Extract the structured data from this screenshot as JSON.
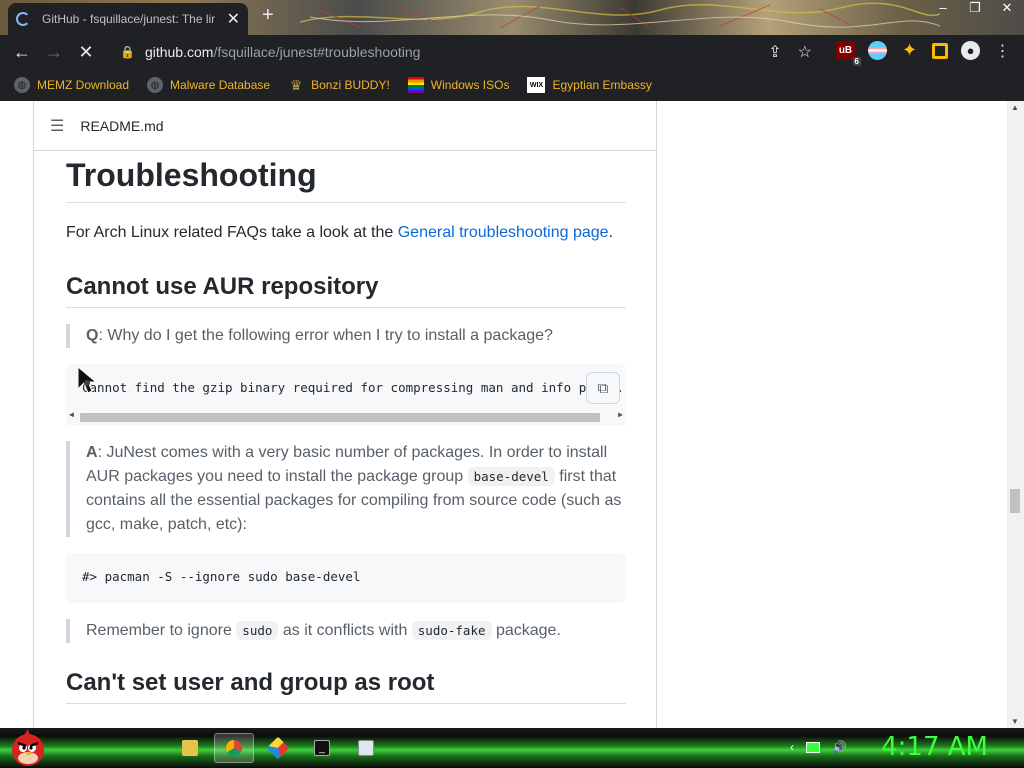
{
  "browser": {
    "tab_title": "GitHub - fsquillace/junest: The lir",
    "tab_close": "✕",
    "new_tab": "+",
    "url_host": "github.com",
    "url_path": "/fsquillace/junest#troubleshooting",
    "extension_badge": "6",
    "ublock_label": "uB"
  },
  "bookmarks": [
    {
      "label": "MEMZ Download",
      "icon": "globe-icon"
    },
    {
      "label": "Malware Database",
      "icon": "globe-icon"
    },
    {
      "label": "Bonzi BUDDY!",
      "icon": "bonzi-icon"
    },
    {
      "label": "Windows ISOs",
      "icon": "rainbow-flag-icon"
    },
    {
      "label": "Egyptian Embassy",
      "icon": "wix-icon"
    }
  ],
  "readme": {
    "filename": "README.md",
    "h1": "Troubleshooting",
    "intro_prefix": "For Arch Linux related FAQs take a look at the ",
    "intro_link": "General troubleshooting page",
    "intro_suffix": ".",
    "h2_aur": "Cannot use AUR repository",
    "q_label": "Q",
    "q_text": ": Why do I get the following error when I try to install a package?",
    "error_code": "Cannot find the gzip binary required for compressing man and info pages.",
    "a_label": "A",
    "a_text_1": ": JuNest comes with a very basic number of packages. In order to install AUR packages you need to install the package group ",
    "a_code": "base-devel",
    "a_text_2": " first that contains all the essential packages for compiling from source code (such as gcc, make, patch, etc):",
    "pacman_cmd": "#> pacman -S --ignore sudo base-devel",
    "remember_1": "Remember to ignore ",
    "remember_code_1": "sudo",
    "remember_2": " as it conflicts with ",
    "remember_code_2": "sudo-fake",
    "remember_3": " package.",
    "h2_root": "Can't set user and group as root"
  },
  "taskbar": {
    "clock": "4:17 AM"
  },
  "colors": {
    "link": "#0969da",
    "bookmark_text": "#f0b429",
    "clock": "#3cff3c",
    "chrome_bg": "#202124"
  }
}
